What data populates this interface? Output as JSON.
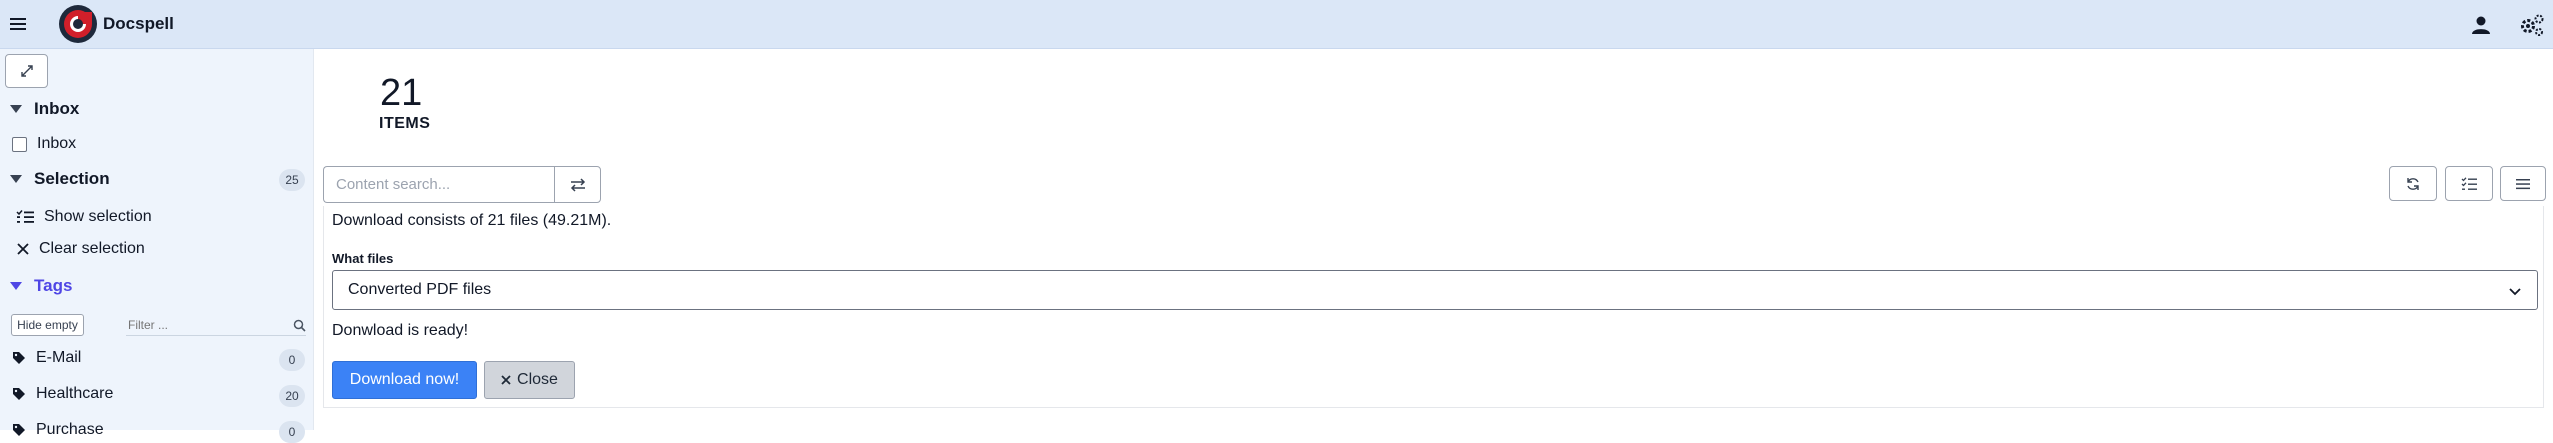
{
  "app": {
    "title": "Docspell"
  },
  "sidebar": {
    "inbox_section": {
      "title": "Inbox",
      "checkbox_label": "Inbox"
    },
    "selection_section": {
      "title": "Selection",
      "count": "25",
      "show_label": "Show selection",
      "clear_label": "Clear selection"
    },
    "tags_section": {
      "title": "Tags",
      "hide_empty_label": "Hide empty",
      "filter_placeholder": "Filter ...",
      "items": [
        {
          "label": "E-Mail",
          "count": "0"
        },
        {
          "label": "Healthcare",
          "count": "20"
        },
        {
          "label": "Purchase",
          "count": "0"
        }
      ]
    }
  },
  "main": {
    "items_count": "21",
    "items_label": "ITEMS",
    "search_placeholder": "Content search...",
    "download": {
      "info": "Download consists of 21 files (49.21M).",
      "what_files_label": "What files",
      "selected_option": "Converted PDF files",
      "status": "Donwload is ready!",
      "download_button": "Download now!",
      "close_button": "Close"
    }
  },
  "colors": {
    "topbar": "#dbe7f7",
    "sidebar": "#eef4fc",
    "accent": "#3b82f6",
    "tags_accent": "#4f46e5",
    "logo_red": "#d11f2a"
  }
}
